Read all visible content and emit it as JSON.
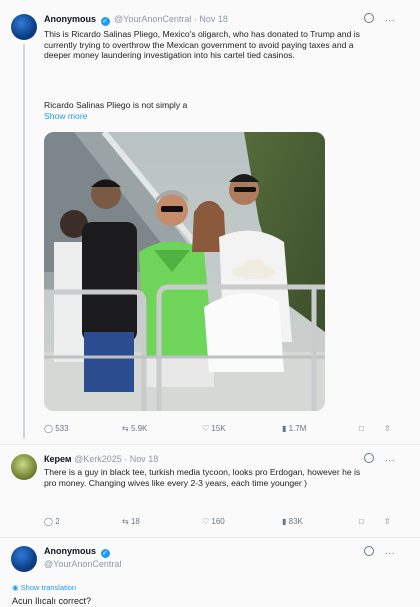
{
  "post1": {
    "name": "Anonymous",
    "handle": "@YourAnonCentral",
    "date": "· Nov 18",
    "text": "This is Ricardo Salinas Pliego, Mexico's oligarch, who has donated to Trump and is currently trying to overthrow the Mexican government to avoid paying taxes and a deeper money laundering investigation into his cartel tied casinos.",
    "text2": "Ricardo Salinas Pliego is not simply a",
    "show_more": "Show more",
    "replies": "533",
    "reposts": "5.9K",
    "likes": "15K",
    "views": "1.7M"
  },
  "post2": {
    "name": "Керем",
    "handle": "@Kerk2025",
    "date": "· Nov 18",
    "text": "There is a guy in black tee, turkish media tycoon, looks pro Erdogan, however he is pro money. Changing wives like every 2-3 years, each time younger )",
    "replies": "2",
    "reposts": "18",
    "likes": "160",
    "views": "83K"
  },
  "post3": {
    "name": "Anonymous",
    "handle": "@YourAnonCentral",
    "translate": "Show translation",
    "text": "Acun Ilıcalı correct?"
  }
}
